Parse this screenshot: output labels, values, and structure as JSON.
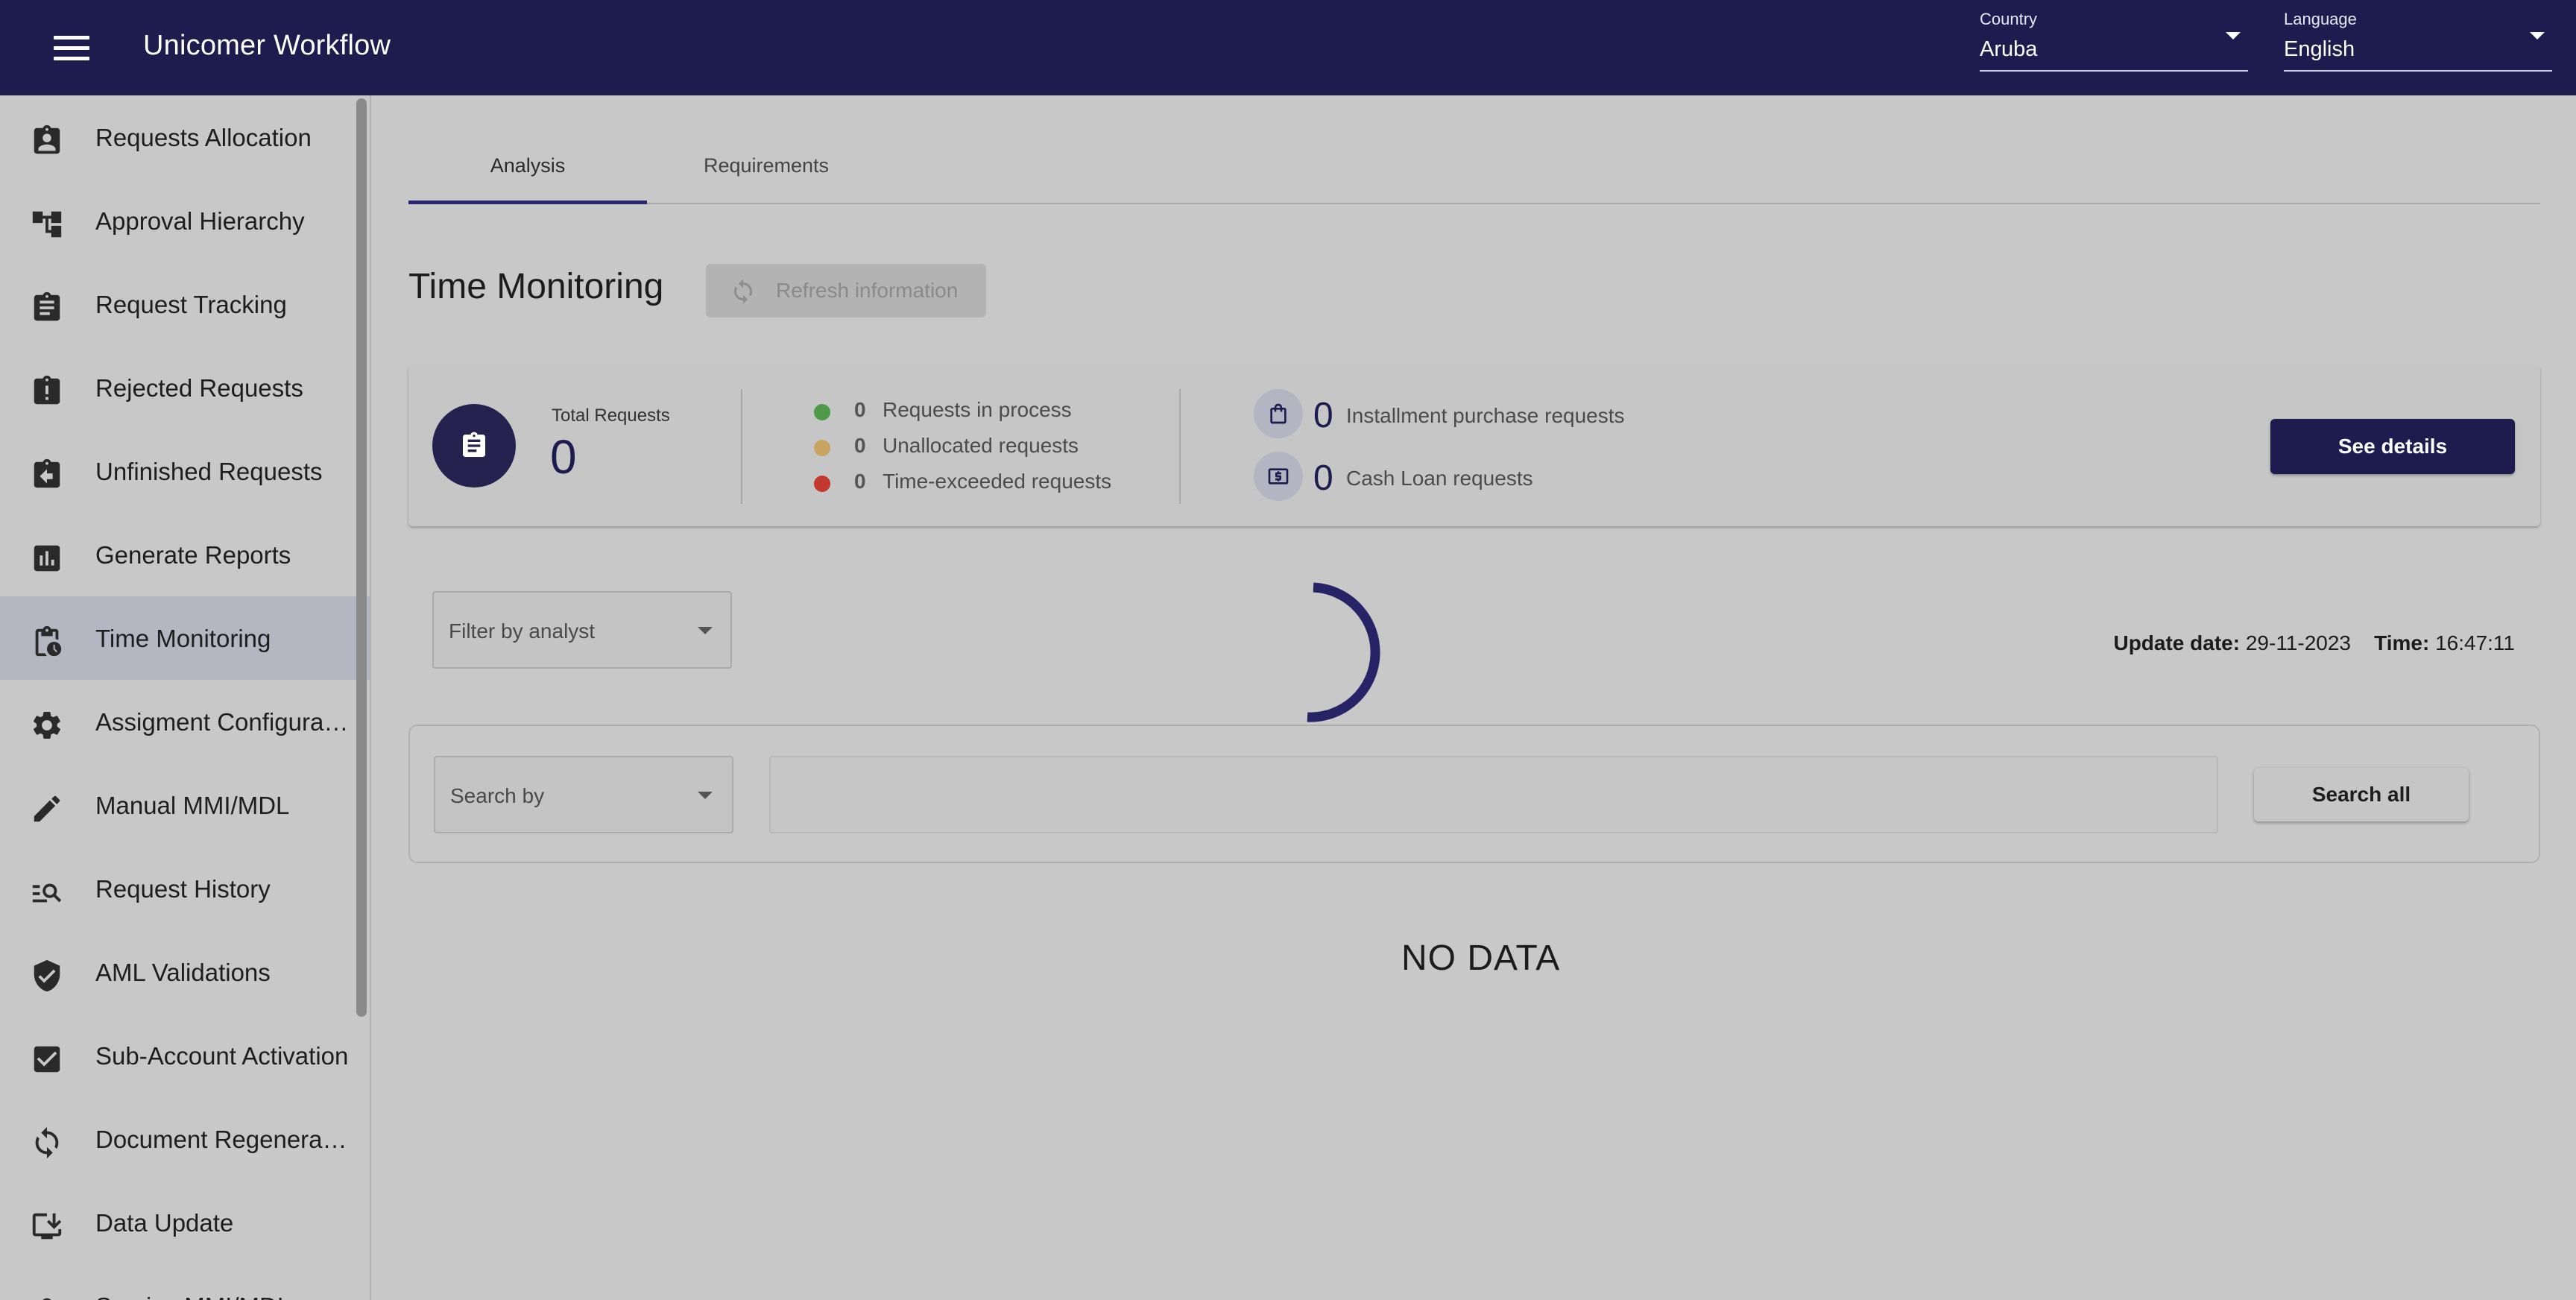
{
  "header": {
    "app_title": "Unicomer Workflow",
    "country": {
      "label": "Country",
      "value": "Aruba"
    },
    "language": {
      "label": "Language",
      "value": "English"
    }
  },
  "sidebar": {
    "items": [
      {
        "label": "Requests Allocation",
        "icon": "assignment-ind-icon"
      },
      {
        "label": "Approval Hierarchy",
        "icon": "account-tree-icon"
      },
      {
        "label": "Request Tracking",
        "icon": "assignment-icon"
      },
      {
        "label": "Rejected Requests",
        "icon": "assignment-late-icon"
      },
      {
        "label": "Unfinished Requests",
        "icon": "assignment-return-icon"
      },
      {
        "label": "Generate Reports",
        "icon": "bar-chart-icon"
      },
      {
        "label": "Time Monitoring",
        "icon": "pending-actions-icon",
        "active": true
      },
      {
        "label": "Assigment Configuration",
        "icon": "gear-icon"
      },
      {
        "label": "Manual MMI/MDL",
        "icon": "pencil-icon"
      },
      {
        "label": "Request History",
        "icon": "manage-search-icon"
      },
      {
        "label": "AML Validations",
        "icon": "shield-check-icon"
      },
      {
        "label": "Sub-Account Activation",
        "icon": "checkbox-icon"
      },
      {
        "label": "Document Regeneration",
        "icon": "sync-icon"
      },
      {
        "label": "Data Update",
        "icon": "install-desktop-icon"
      },
      {
        "label": "Service MMI/MDL",
        "icon": "person-icon"
      }
    ]
  },
  "tabs": {
    "analysis": "Analysis",
    "requirements": "Requirements"
  },
  "section": {
    "title": "Time Monitoring",
    "refresh_label": "Refresh information"
  },
  "summary": {
    "total_label": "Total Requests",
    "total_value": "0",
    "statuses": [
      {
        "count": "0",
        "label": "Requests in process",
        "color": "#4f9a4a"
      },
      {
        "count": "0",
        "label": "Unallocated requests",
        "color": "#c9a460"
      },
      {
        "count": "0",
        "label": "Time-exceeded requests",
        "color": "#c2382e"
      }
    ],
    "types": [
      {
        "count": "0",
        "label": "Installment purchase requests",
        "icon": "shopping-bag-icon"
      },
      {
        "count": "0",
        "label": "Cash Loan requests",
        "icon": "money-icon"
      }
    ],
    "details_button": "See details"
  },
  "filter": {
    "placeholder": "Filter by analyst"
  },
  "update": {
    "date_label": "Update date:",
    "date_value": "29-11-2023",
    "time_label": "Time:",
    "time_value": "16:47:11"
  },
  "search": {
    "by_placeholder": "Search by",
    "input_value": "",
    "button": "Search all"
  },
  "empty_message": "NO DATA",
  "colors": {
    "primary": "#1e1b4e",
    "background": "#c8c8c8"
  }
}
